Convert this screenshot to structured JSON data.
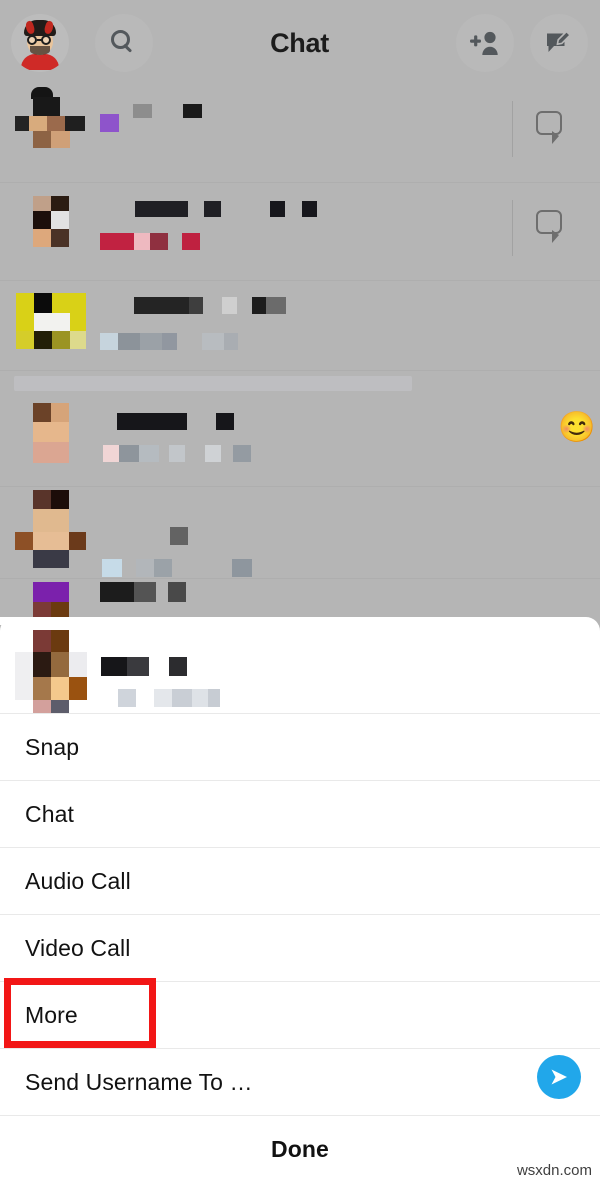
{
  "header": {
    "title": "Chat",
    "avatar_icon": "bitmoji-avatar",
    "search_icon": "search-icon",
    "add_friend_icon": "add-friend-icon",
    "new_chat_icon": "new-chat-pencil-icon"
  },
  "chat_list": {
    "note": "conversation names and previews are pixelated/redacted in the screenshot",
    "rows": [
      {
        "name_redacted": true,
        "preview_redacted": true,
        "action_icon": "chat-bubble-icon",
        "emoji": ""
      },
      {
        "name_redacted": true,
        "preview_redacted": true,
        "action_icon": "chat-bubble-icon",
        "emoji": ""
      },
      {
        "name_redacted": true,
        "preview_redacted": true,
        "action_icon": "",
        "emoji": ""
      },
      {
        "name_redacted": true,
        "preview_redacted": true,
        "action_icon": "",
        "emoji": "😊"
      },
      {
        "name_redacted": true,
        "preview_redacted": true,
        "action_icon": "",
        "emoji": ""
      },
      {
        "name_redacted": true,
        "preview_redacted": true,
        "action_icon": "",
        "emoji": ""
      }
    ]
  },
  "sheet": {
    "contact_name_redacted": true,
    "items": [
      {
        "label": "Snap",
        "highlighted": false
      },
      {
        "label": "Chat",
        "highlighted": false
      },
      {
        "label": "Audio Call",
        "highlighted": false
      },
      {
        "label": "Video Call",
        "highlighted": false
      },
      {
        "label": "More",
        "highlighted": true
      },
      {
        "label": "Send Username To …",
        "highlighted": false,
        "trailing_icon": "send-arrow-icon"
      }
    ],
    "done_label": "Done"
  },
  "annotation": {
    "highlight_color": "#f21616",
    "highlight_target": "More"
  },
  "colors": {
    "dim_background": "#b5b5b5",
    "sheet_background": "#ffffff",
    "send_button": "#21a7ea",
    "text_primary": "#121212"
  },
  "watermark": {
    "text": "wsxdn.com"
  }
}
